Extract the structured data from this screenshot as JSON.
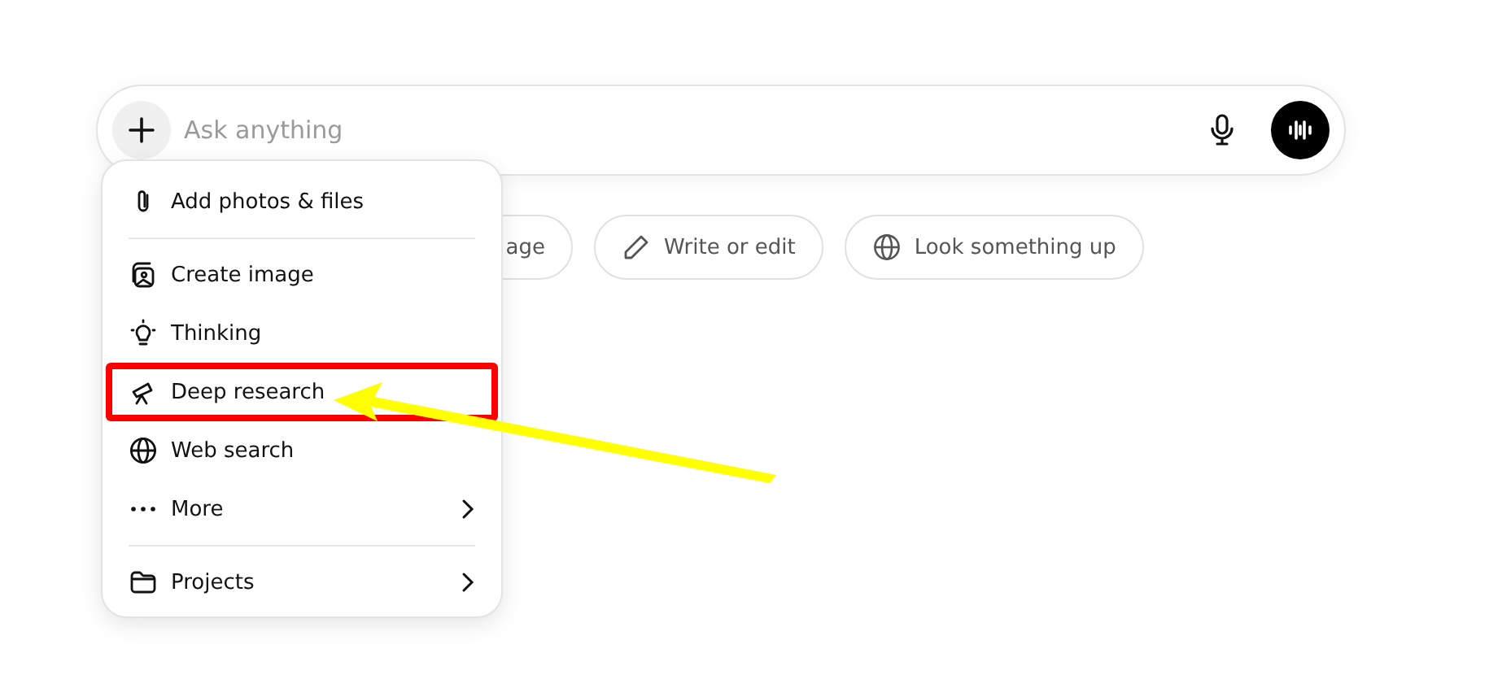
{
  "composer": {
    "placeholder": "Ask anything"
  },
  "chips": [
    {
      "label": "age",
      "partial": true
    },
    {
      "label": "Write or edit",
      "partial": false
    },
    {
      "label": "Look something up",
      "partial": false
    }
  ],
  "menu": {
    "groups": [
      [
        {
          "label": "Add photos & files",
          "submenu": false,
          "highlighted": false
        }
      ],
      [
        {
          "label": "Create image",
          "submenu": false,
          "highlighted": false
        },
        {
          "label": "Thinking",
          "submenu": false,
          "highlighted": false
        },
        {
          "label": "Deep research",
          "submenu": false,
          "highlighted": true
        },
        {
          "label": "Web search",
          "submenu": false,
          "highlighted": false
        },
        {
          "label": "More",
          "submenu": true,
          "highlighted": false
        }
      ],
      [
        {
          "label": "Projects",
          "submenu": true,
          "highlighted": false
        }
      ]
    ]
  }
}
